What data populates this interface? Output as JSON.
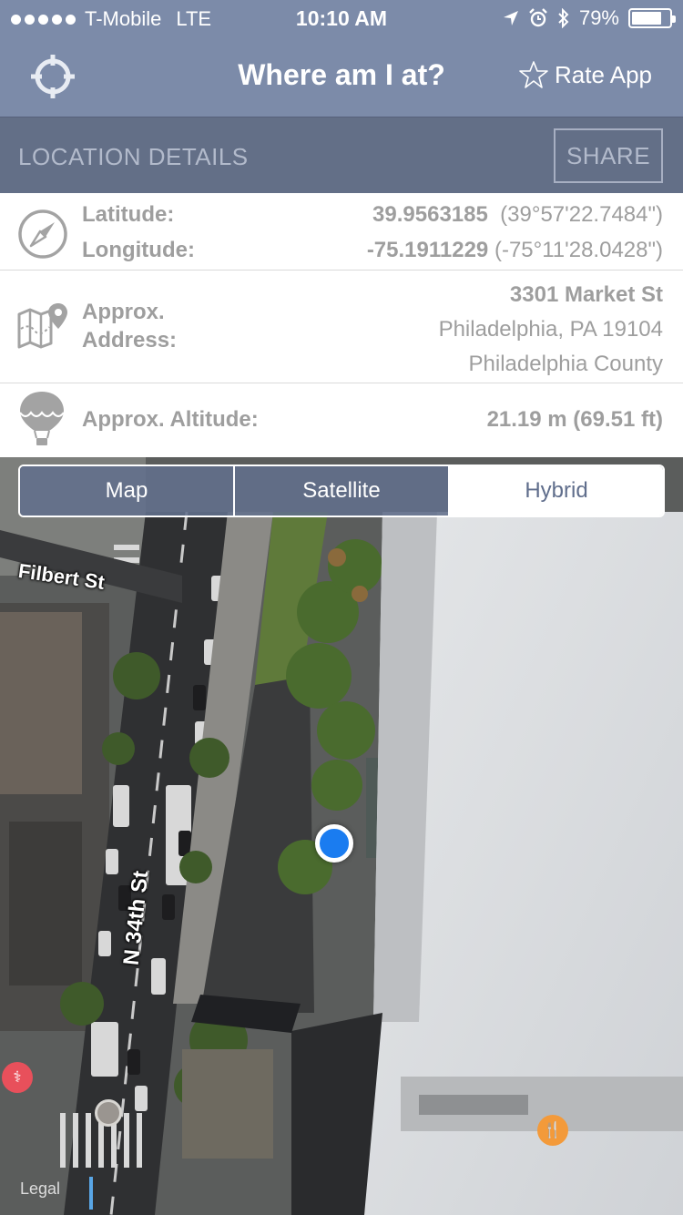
{
  "status_bar": {
    "carrier": "T-Mobile",
    "network": "LTE",
    "time": "10:10 AM",
    "battery": "79%",
    "battery_level": 0.79
  },
  "nav": {
    "title": "Where am I at?",
    "rate_label": "Rate App",
    "icons": [
      "crosshair-icon",
      "star-icon"
    ]
  },
  "details_bar": {
    "label": "LOCATION DETAILS",
    "share_label": "SHARE"
  },
  "coords": {
    "latitude_label": "Latitude:",
    "latitude_value": "39.9563185",
    "latitude_dms": "(39°57'22.7484\")",
    "longitude_label": "Longitude:",
    "longitude_value": "-75.1911229",
    "longitude_dms": "(-75°11'28.0428\")"
  },
  "address": {
    "label": "Approx. Address:",
    "line1": "3301 Market St",
    "line2": "Philadelphia, PA 19104",
    "line3": "Philadelphia County"
  },
  "altitude": {
    "label": "Approx. Altitude:",
    "value": "21.19 m (69.51 ft)"
  },
  "map": {
    "segments": [
      "Map",
      "Satellite",
      "Hybrid"
    ],
    "selected_segment": "Hybrid",
    "streets": [
      "Filbert St",
      "N 34th St"
    ],
    "legal": "Legal",
    "colors": {
      "user_location": "#1a7cf0",
      "medical_poi": "#e8505b",
      "food_poi": "#f39a3a"
    }
  },
  "colors": {
    "nav_bar": "#7c8ba9",
    "details_bar": "#636f87",
    "text_gray": "#9e9e9e"
  }
}
